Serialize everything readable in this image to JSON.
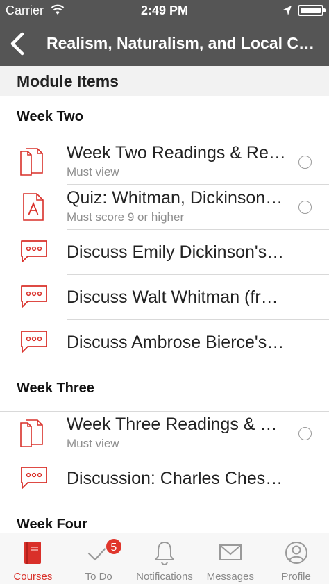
{
  "status_bar": {
    "carrier": "Carrier",
    "time": "2:49 PM"
  },
  "nav": {
    "title": "Realism, Naturalism, and Local Color"
  },
  "module": {
    "header": "Module Items",
    "groups": [
      {
        "title": "Week Two",
        "items": [
          {
            "icon": "document-icon",
            "title": "Week Two Readings & Resources",
            "subtitle": "Must view",
            "checkable": true
          },
          {
            "icon": "quiz-icon",
            "title": "Quiz: Whitman, Dickinson, and Bierce",
            "subtitle": "Must score 9 or higher",
            "checkable": true
          },
          {
            "icon": "discussion-icon",
            "title": "Discuss Emily Dickinson's Poetry",
            "subtitle": "",
            "checkable": false
          },
          {
            "icon": "discussion-icon",
            "title": "Discuss Walt Whitman (from Song of Myself)",
            "subtitle": "",
            "checkable": false
          },
          {
            "icon": "discussion-icon",
            "title": "Discuss Ambrose Bierce's Story",
            "subtitle": "",
            "checkable": false
          }
        ]
      },
      {
        "title": "Week Three",
        "items": [
          {
            "icon": "document-icon",
            "title": "Week Three Readings & Resources",
            "subtitle": "Must view",
            "checkable": true
          },
          {
            "icon": "discussion-icon",
            "title": "Discussion: Charles Chesnutt",
            "subtitle": "",
            "checkable": false
          }
        ]
      },
      {
        "title": "Week Four",
        "items": []
      }
    ]
  },
  "tabs": [
    {
      "label": "Courses",
      "active": true
    },
    {
      "label": "To Do",
      "badge": "5"
    },
    {
      "label": "Notifications"
    },
    {
      "label": "Messages"
    },
    {
      "label": "Profile"
    }
  ],
  "colors": {
    "accent": "#d9302a",
    "header_bg": "#555555",
    "tab_inactive": "#8a8a8a"
  }
}
